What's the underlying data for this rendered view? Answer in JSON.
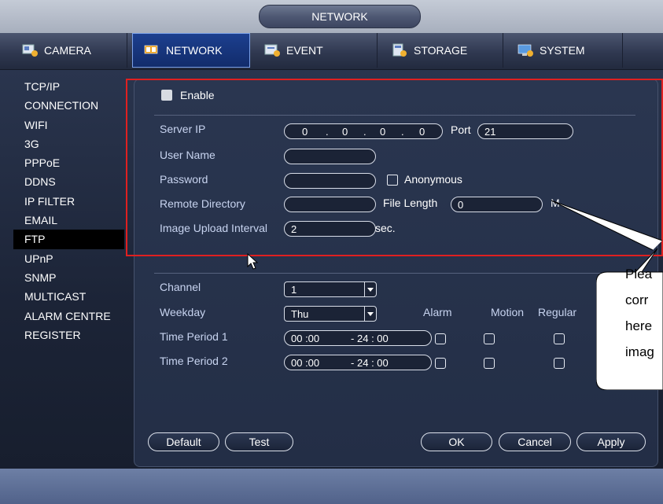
{
  "window": {
    "title": "NETWORK"
  },
  "tabs": [
    {
      "label": "CAMERA",
      "icon": "camera-icon"
    },
    {
      "label": "NETWORK",
      "icon": "network-icon",
      "active": true
    },
    {
      "label": "EVENT",
      "icon": "event-icon"
    },
    {
      "label": "STORAGE",
      "icon": "storage-icon"
    },
    {
      "label": "SYSTEM",
      "icon": "system-icon"
    }
  ],
  "sidebar": {
    "items": [
      {
        "label": "TCP/IP"
      },
      {
        "label": "CONNECTION"
      },
      {
        "label": "WIFI"
      },
      {
        "label": "3G"
      },
      {
        "label": "PPPoE"
      },
      {
        "label": "DDNS"
      },
      {
        "label": "IP FILTER"
      },
      {
        "label": "EMAIL"
      },
      {
        "label": "FTP",
        "active": true
      },
      {
        "label": "UPnP"
      },
      {
        "label": "SNMP"
      },
      {
        "label": "MULTICAST"
      },
      {
        "label": "ALARM CENTRE"
      },
      {
        "label": "REGISTER"
      }
    ]
  },
  "form": {
    "enable_label": "Enable",
    "enable_checked": true,
    "server_ip_label": "Server IP",
    "server_ip": [
      "0",
      "0",
      "0",
      "0"
    ],
    "port_label": "Port",
    "port_value": "21",
    "user_name_label": "User Name",
    "user_name_value": "",
    "password_label": "Password",
    "password_value": "",
    "anonymous_label": "Anonymous",
    "remote_directory_label": "Remote Directory",
    "remote_directory_value": "",
    "file_length_label": "File Length",
    "file_length_value": "0",
    "file_length_unit": "M",
    "image_upload_interval_label": "Image Upload Interval",
    "image_upload_interval_value": "2",
    "image_upload_interval_unit": "sec."
  },
  "schedule": {
    "channel_label": "Channel",
    "channel_value": "1",
    "weekday_label": "Weekday",
    "weekday_value": "Thu",
    "columns": [
      "Alarm",
      "Motion",
      "Regular"
    ],
    "periods": [
      {
        "label": "Time Period 1",
        "start": "00 :00",
        "end": "24 : 00"
      },
      {
        "label": "Time Period 2",
        "start": "00 :00",
        "end": "24 : 00"
      }
    ]
  },
  "buttons": {
    "default": "Default",
    "test": "Test",
    "ok": "OK",
    "cancel": "Cancel",
    "apply": "Apply"
  },
  "callout": {
    "lines": [
      "Plea",
      "corr",
      "here",
      "imag"
    ]
  },
  "colors": {
    "highlight": "#e02020",
    "active_tab": "#1c3f8f"
  }
}
